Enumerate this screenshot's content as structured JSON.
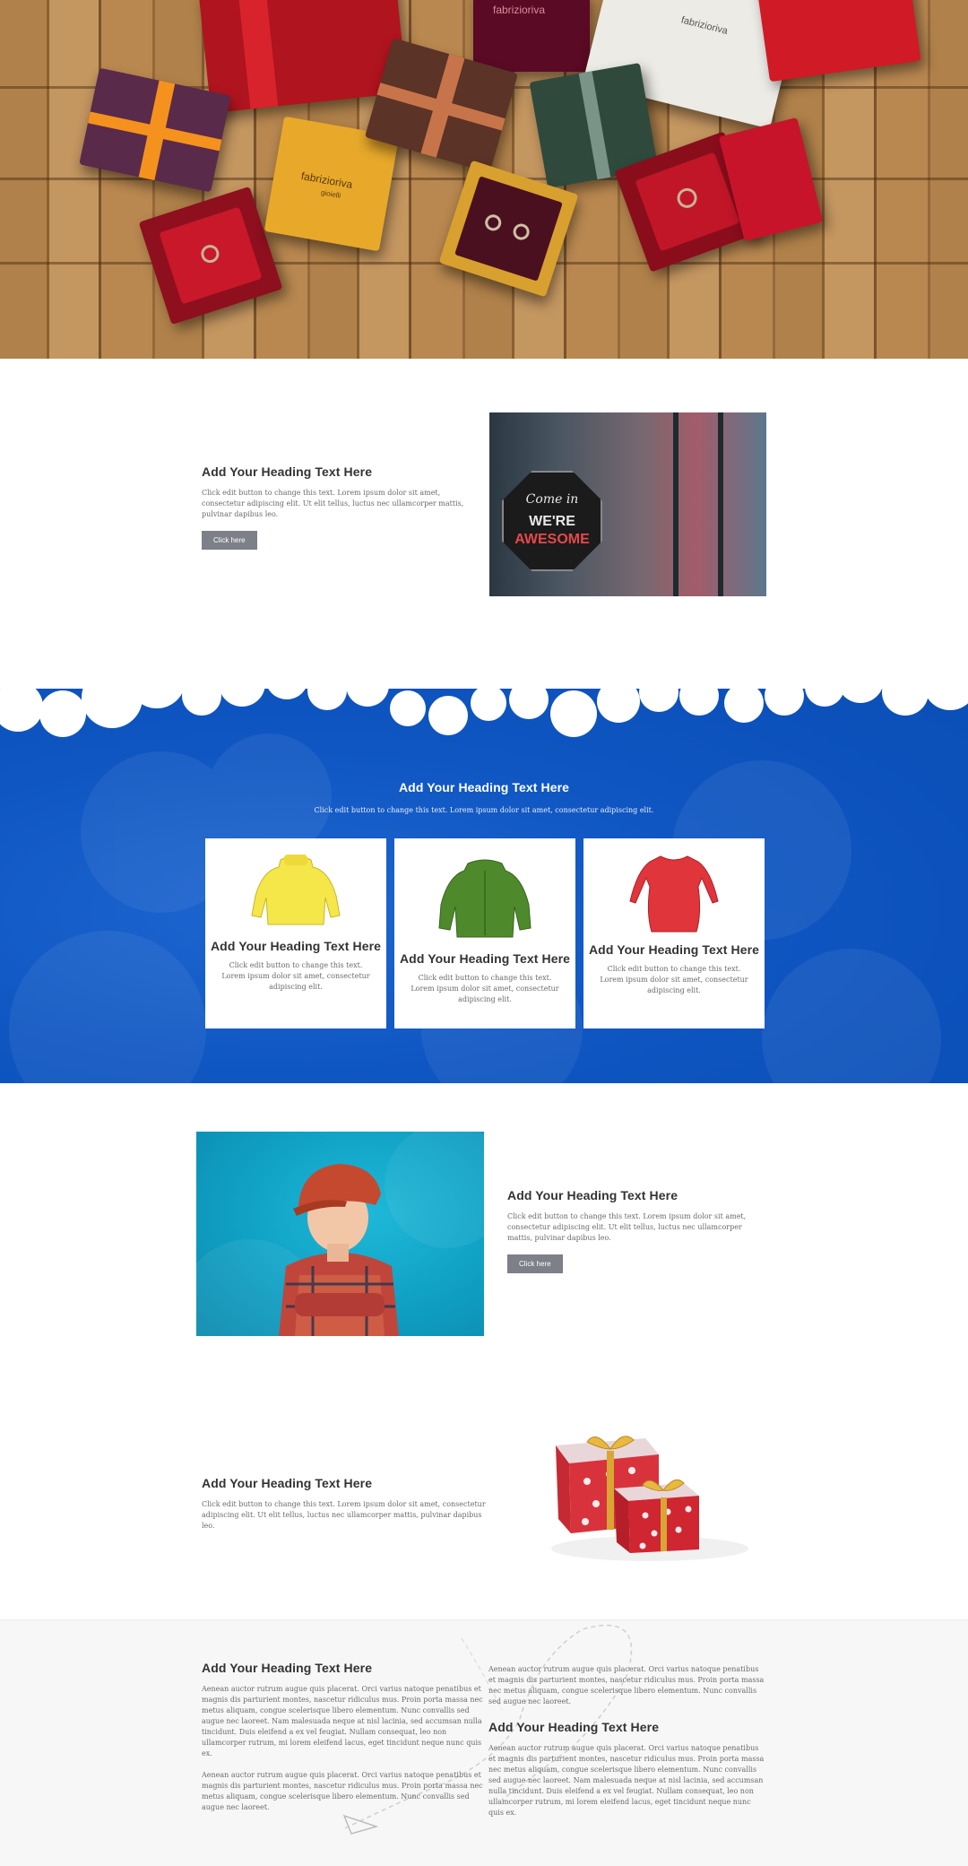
{
  "hero": {
    "brand_text": "fabrizioriva",
    "brand_sub": "gioielli",
    "brand_text_2": "fabrizioriva",
    "brand_text_3": "fabrizioriva"
  },
  "section_two": {
    "heading": "Add Your Heading Text Here",
    "text": "Click edit button to change this text. Lorem ipsum dolor sit amet, consectetur adipiscing elit. Ut elit tellus, luctus nec ullamcorper mattis, pulvinar dapibus leo.",
    "button": "Click here",
    "sign_top": "Come in",
    "sign_mid": "WE'RE",
    "sign_bottom": "AWESOME"
  },
  "blue_section": {
    "heading": "Add Your Heading Text Here",
    "subtext": "Click edit button to change this text. Lorem ipsum dolor sit amet, consectetur adipiscing elit.",
    "cards": [
      {
        "heading": "Add Your Heading Text Here",
        "text": "Click edit button to change this text. Lorem ipsum dolor sit amet, consectetur adipiscing elit.",
        "icon": "yellow-sweater-icon",
        "color": "#f5e64a"
      },
      {
        "heading": "Add Your Heading Text Here",
        "text": "Click edit button to change this text. Lorem ipsum dolor sit amet, consectetur adipiscing elit.",
        "icon": "green-sweater-icon",
        "color": "#4e8a2c"
      },
      {
        "heading": "Add Your Heading Text Here",
        "text": "Click edit button to change this text. Lorem ipsum dolor sit amet, consectetur adipiscing elit.",
        "icon": "red-dress-icon",
        "color": "#e0353b"
      }
    ]
  },
  "boy_section": {
    "heading": "Add Your Heading Text Here",
    "text": "Click edit button to change this text. Lorem ipsum dolor sit amet, consectetur adipiscing elit. Ut elit tellus, luctus nec ullamcorper mattis, pulvinar dapibus leo.",
    "button": "Click here"
  },
  "gift_section": {
    "heading": "Add Your Heading Text Here",
    "text": "Click edit button to change this text. Lorem ipsum dolor sit amet, consectetur adipiscing elit. Ut elit tellus, luctus nec ullamcorper mattis, pulvinar dapibus leo."
  },
  "footer": {
    "left_heading": "Add Your Heading Text Here",
    "left_para_1": "Aenean auctor rutrum augue quis placerat. Orci varius natoque penatibus et magnis dis parturient montes, nascetur ridiculus mus. Proin porta massa nec metus aliquam, congue scelerisque libero elementum. Nunc convallis sed augue nec laoreet. Nam malesuada neque at nisl lacinia, sed accumsan nulla tincidunt. Duis eleifend a ex vel feugiat. Nullam consequat, leo non ullamcorper rutrum, mi lorem eleifend lacus, eget tincidunt neque nunc quis ex.",
    "left_para_2": "Aenean auctor rutrum augue quis placerat. Orci varius natoque penatibus et magnis dis parturient montes, nascetur ridiculus mus. Proin porta massa nec metus aliquam, congue scelerisque libero elementum. Nunc convallis sed augue nec laoreet.",
    "right_para_1": "Aenean auctor rutrum augue quis placerat. Orci varius natoque penatibus et magnis dis parturient montes, nascetur ridiculus mus. Proin porta massa nec metus aliquam, congue scelerisque libero elementum. Nunc convallis sed augue nec laoreet.",
    "right_heading": "Add Your Heading Text Here",
    "right_para_2": "Aenean auctor rutrum augue quis placerat. Orci varius natoque penatibus et magnis dis parturient montes, nascetur ridiculus mus. Proin porta massa nec metus aliquam, congue scelerisque libero elementum. Nunc convallis sed augue nec laoreet. Nam malesuada neque at nisl lacinia, sed accumsan nulla tincidunt. Duis eleifend a ex vel feugiat. Nullam consequat, leo non ullamcorper rutrum, mi lorem eleifend lacus, eget tincidunt neque nunc quis ex."
  },
  "colors": {
    "blue_bg": "#0f56c2",
    "button_bg": "#7d8088",
    "footer_bg": "#f7f7f7"
  }
}
